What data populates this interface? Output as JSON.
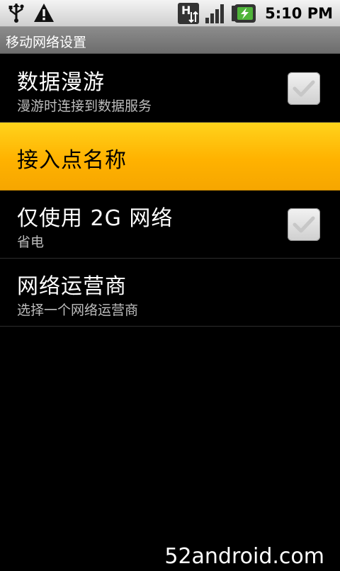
{
  "status_bar": {
    "left_icons": [
      "usb-icon",
      "warning-icon"
    ],
    "right_icons": [
      "hsdpa-data-icon",
      "signal-strength-icon",
      "battery-charging-icon"
    ],
    "time": "5:10 PM"
  },
  "title_bar": {
    "title": "移动网络设置"
  },
  "list": {
    "items": [
      {
        "title": "数据漫游",
        "summary": "漫游时连接到数据服务",
        "checkbox": true,
        "checked": false
      },
      {
        "title": "接入点名称",
        "summary": "",
        "highlighted": true
      },
      {
        "title": "仅使用 2G 网络",
        "summary": "省电",
        "checkbox": true,
        "checked": false
      },
      {
        "title": "网络运营商",
        "summary": "选择一个网络运营商"
      }
    ]
  },
  "watermark": "52android.com",
  "colors": {
    "highlight": "#ffb200",
    "background": "#000000",
    "summary_text": "#bdbdbd"
  }
}
